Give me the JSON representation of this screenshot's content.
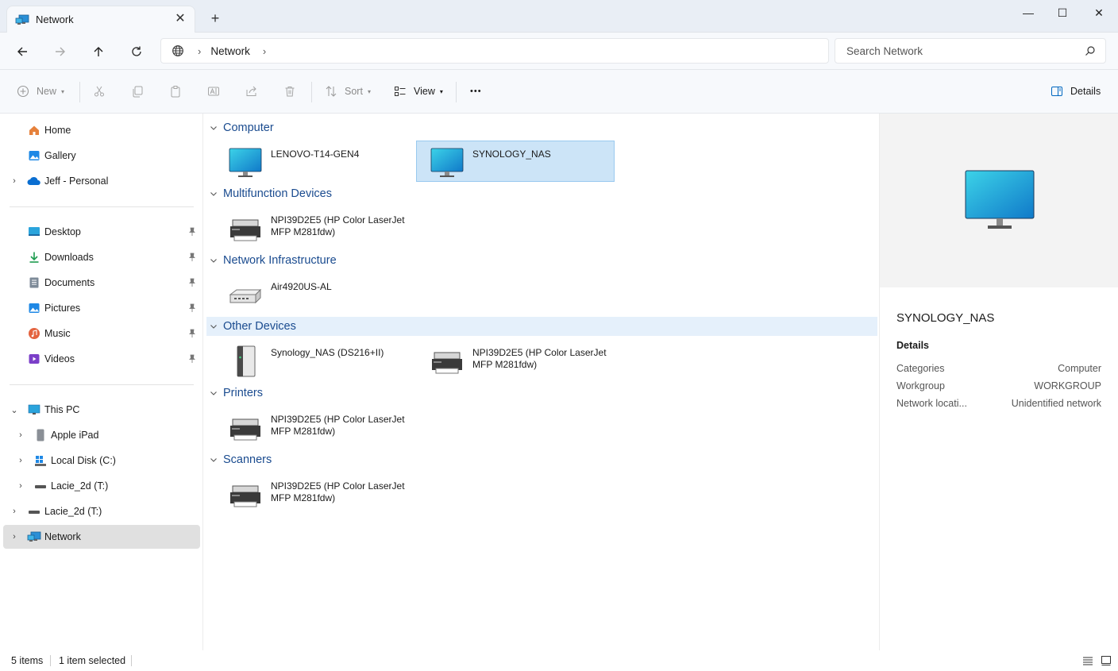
{
  "window": {
    "tab_title": "Network",
    "tab_icon": "network-icon",
    "new_tab": "+",
    "controls": [
      "minimize",
      "maximize",
      "close"
    ]
  },
  "address": {
    "crumb": "Network",
    "search_placeholder": "Search Network"
  },
  "commandbar": {
    "new": "New",
    "sort": "Sort",
    "view": "View",
    "more": "•••",
    "details": "Details"
  },
  "nav": {
    "home": "Home",
    "gallery": "Gallery",
    "onedrive": "Jeff - Personal",
    "desktop": "Desktop",
    "downloads": "Downloads",
    "documents": "Documents",
    "pictures": "Pictures",
    "music": "Music",
    "videos": "Videos",
    "this_pc": "This PC",
    "apple_ipad": "Apple iPad",
    "local_disk": "Local Disk (C:)",
    "lacie_sub": "Lacie_2d (T:)",
    "lacie_root": "Lacie_2d (T:)",
    "network": "Network"
  },
  "groups": {
    "computer": {
      "title": "Computer",
      "items": [
        "LENOVO-T14-GEN4",
        "SYNOLOGY_NAS"
      ]
    },
    "multifunction": {
      "title": "Multifunction Devices",
      "items": [
        "NPI39D2E5 (HP Color LaserJet MFP M281fdw)"
      ]
    },
    "infrastructure": {
      "title": "Network Infrastructure",
      "items": [
        "Air4920US-AL"
      ]
    },
    "other": {
      "title": "Other Devices",
      "items": [
        "Synology_NAS (DS216+II)",
        "NPI39D2E5 (HP Color LaserJet MFP M281fdw)"
      ]
    },
    "printers": {
      "title": "Printers",
      "items": [
        "NPI39D2E5 (HP Color LaserJet MFP M281fdw)"
      ]
    },
    "scanners": {
      "title": "Scanners",
      "items": [
        "NPI39D2E5 (HP Color LaserJet MFP M281fdw)"
      ]
    }
  },
  "details": {
    "name": "SYNOLOGY_NAS",
    "section": "Details",
    "props": [
      {
        "key": "Categories",
        "value": "Computer"
      },
      {
        "key": "Workgroup",
        "value": "WORKGROUP"
      },
      {
        "key": "Network locati...",
        "value": "Unidentified network"
      }
    ]
  },
  "status": {
    "count": "5 items",
    "selected": "1 item selected"
  },
  "colors": {
    "selection": "#cce4f7",
    "group_header": "#1a4b8f",
    "accent": "#0067c0"
  }
}
